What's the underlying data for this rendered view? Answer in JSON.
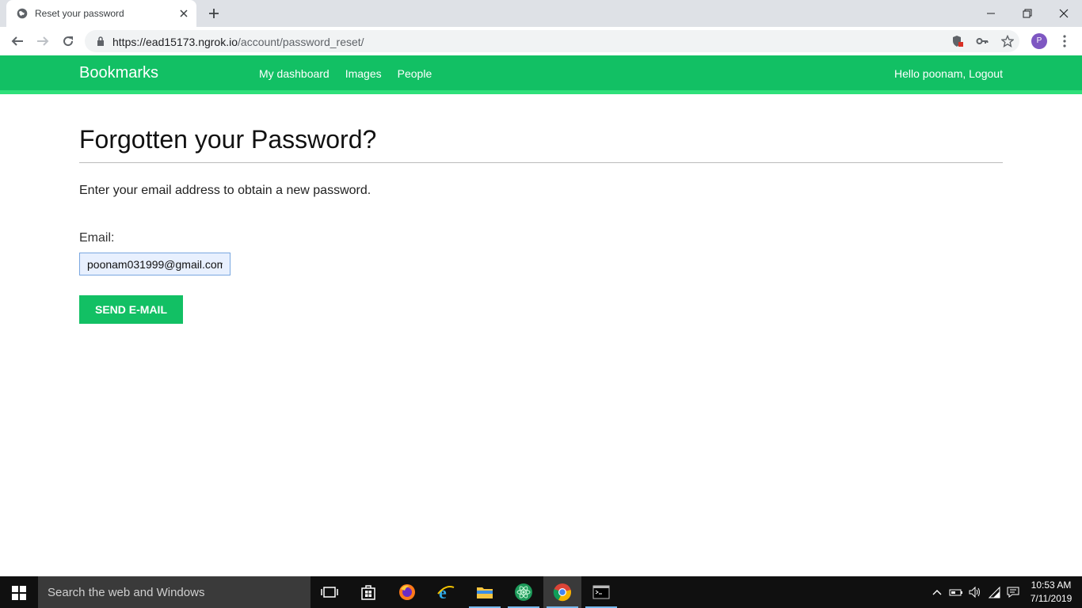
{
  "browser": {
    "tab_title": "Reset your password",
    "url_host": "https://ead15173.ngrok.io",
    "url_path": "/account/password_reset/",
    "profile_initial": "P"
  },
  "site": {
    "logo": "Bookmarks",
    "nav": [
      "My dashboard",
      "Images",
      "People"
    ],
    "user_text": "Hello poonam, Logout"
  },
  "page": {
    "title": "Forgotten your Password?",
    "intro": "Enter your email address to obtain a new password.",
    "email_label": "Email:",
    "email_value": "poonam031999@gmail.com",
    "send_button": "SEND E-MAIL"
  },
  "taskbar": {
    "search_placeholder": "Search the web and Windows",
    "time": "10:53 AM",
    "date": "7/11/2019"
  },
  "colors": {
    "brand_green": "#12c064",
    "header_underline": "#2ee07a"
  }
}
